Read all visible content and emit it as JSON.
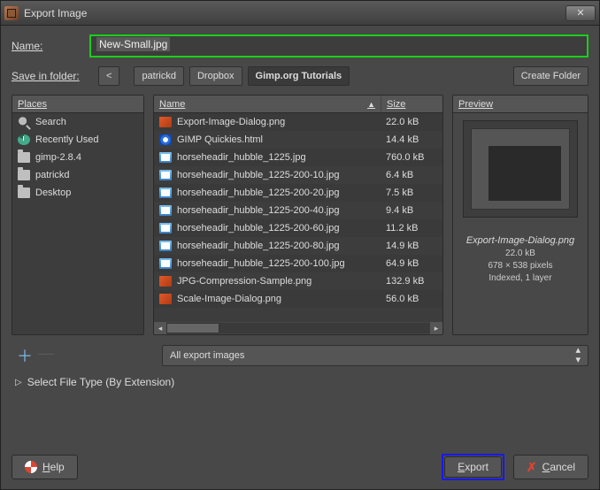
{
  "window": {
    "title": "Export Image"
  },
  "name": {
    "label": "Name:",
    "value": "New-Small.jpg"
  },
  "save_in_folder": {
    "label": "Save in folder:",
    "back": "<",
    "crumbs": [
      "patrickd",
      "Dropbox",
      "Gimp.org Tutorials"
    ]
  },
  "create_folder": "Create Folder",
  "places": {
    "header": "Places",
    "items": [
      {
        "icon": "search",
        "label": "Search"
      },
      {
        "icon": "recent",
        "label": "Recently Used"
      },
      {
        "icon": "folder",
        "label": "gimp-2.8.4"
      },
      {
        "icon": "folder",
        "label": "patrickd"
      },
      {
        "icon": "folder",
        "label": "Desktop"
      }
    ]
  },
  "files": {
    "headers": {
      "name": "Name",
      "size": "Size"
    },
    "rows": [
      {
        "icon": "png",
        "name": "Export-Image-Dialog.png",
        "size": "22.0 kB"
      },
      {
        "icon": "html",
        "name": "GIMP Quickies.html",
        "size": "14.4 kB"
      },
      {
        "icon": "jpg",
        "name": "horseheadir_hubble_1225.jpg",
        "size": "760.0 kB"
      },
      {
        "icon": "jpg",
        "name": "horseheadir_hubble_1225-200-10.jpg",
        "size": "6.4 kB"
      },
      {
        "icon": "jpg",
        "name": "horseheadir_hubble_1225-200-20.jpg",
        "size": "7.5 kB"
      },
      {
        "icon": "jpg",
        "name": "horseheadir_hubble_1225-200-40.jpg",
        "size": "9.4 kB"
      },
      {
        "icon": "jpg",
        "name": "horseheadir_hubble_1225-200-60.jpg",
        "size": "11.2 kB"
      },
      {
        "icon": "jpg",
        "name": "horseheadir_hubble_1225-200-80.jpg",
        "size": "14.9 kB"
      },
      {
        "icon": "jpg",
        "name": "horseheadir_hubble_1225-200-100.jpg",
        "size": "64.9 kB"
      },
      {
        "icon": "png",
        "name": "JPG-Compression-Sample.png",
        "size": "132.9 kB"
      },
      {
        "icon": "png",
        "name": "Scale-Image-Dialog.png",
        "size": "56.0 kB"
      }
    ]
  },
  "preview": {
    "header": "Preview",
    "filename": "Export-Image-Dialog.png",
    "size": "22.0 kB",
    "dims": "678 × 538 pixels",
    "mode": "Indexed, 1 layer"
  },
  "filter": {
    "label": "All export images"
  },
  "filetype": {
    "label": "Select File Type (By Extension)"
  },
  "buttons": {
    "help": "Help",
    "export": "Export",
    "cancel": "Cancel"
  }
}
